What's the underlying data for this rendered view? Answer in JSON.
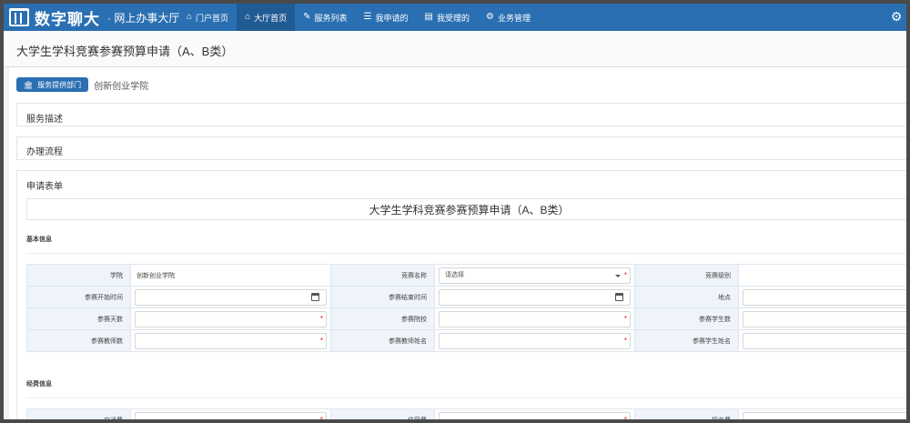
{
  "app": {
    "logo_name": "数字聊大",
    "logo_sub": "· 网上办事大厅"
  },
  "nav": {
    "items": [
      {
        "label": "门户首页",
        "icon": "home-icon"
      },
      {
        "label": "大厅首页",
        "icon": "home-icon",
        "active": true
      },
      {
        "label": "服务列表",
        "icon": "edit-icon"
      },
      {
        "label": "我申请的",
        "icon": "list-icon"
      },
      {
        "label": "我受理的",
        "icon": "card-icon"
      },
      {
        "label": "业务管理",
        "icon": "cogs-icon"
      }
    ]
  },
  "page": {
    "title": "大学生学科竞赛参赛预算申请（A、B类）"
  },
  "department": {
    "button_label": "服务提供部门",
    "name": "创新创业学院"
  },
  "sections": {
    "service_desc": "服务描述",
    "process": "办理流程",
    "form": "申请表单"
  },
  "form": {
    "title": "大学生学科竞赛参赛预算申请（A、B类）",
    "basic_info_label": "基本信息",
    "fee_info_label": "经费信息",
    "basic_rows": [
      [
        {
          "label": "学院",
          "value": "创新创业学院",
          "kind": "text"
        },
        {
          "label": "竞赛名称",
          "value": "请选择",
          "kind": "select",
          "required": true
        },
        {
          "label": "竞赛级别",
          "value": "",
          "kind": "none"
        }
      ],
      [
        {
          "label": "参赛开始时间",
          "value": "",
          "kind": "date"
        },
        {
          "label": "参赛结束时间",
          "value": "",
          "kind": "date"
        },
        {
          "label": "地点",
          "value": "",
          "kind": "input"
        }
      ],
      [
        {
          "label": "参赛天数",
          "value": "",
          "kind": "input",
          "required": true
        },
        {
          "label": "参赛院校",
          "value": "",
          "kind": "input",
          "required": true,
          "tiny": true
        },
        {
          "label": "参赛学生数",
          "value": "",
          "kind": "input"
        }
      ],
      [
        {
          "label": "参赛教师数",
          "value": "",
          "kind": "input",
          "required": true
        },
        {
          "label": "参赛教师姓名",
          "value": "",
          "kind": "input",
          "required": true
        },
        {
          "label": "参赛学生姓名",
          "value": "",
          "kind": "input",
          "tiny": true
        }
      ]
    ],
    "fee_rows": [
      [
        {
          "label": "交通费",
          "value": "",
          "kind": "input",
          "required": true
        },
        {
          "label": "住宿费",
          "value": "",
          "kind": "input",
          "required": true
        },
        {
          "label": "报名费",
          "value": "",
          "kind": "input"
        }
      ]
    ],
    "required_mark": "*"
  },
  "colors": {
    "nav_bg": "#2a6fb2",
    "nav_active": "#215b93",
    "label_bg": "#eef4fa",
    "required": "#e02020"
  }
}
